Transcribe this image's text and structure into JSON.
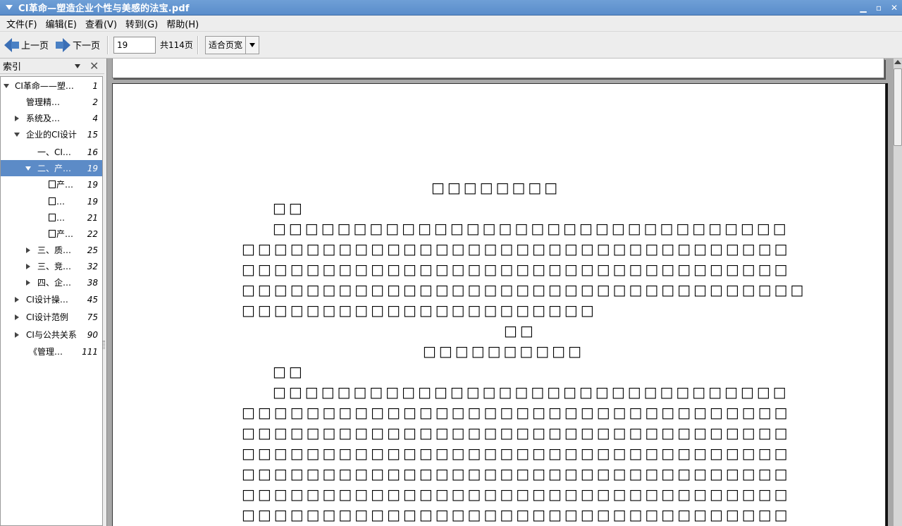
{
  "window": {
    "title": "CI革命—塑造企业个性与美感的法宝.pdf"
  },
  "menubar": [
    {
      "label": "文件(F)"
    },
    {
      "label": "编辑(E)"
    },
    {
      "label": "查看(V)"
    },
    {
      "label": "转到(G)"
    },
    {
      "label": "帮助(H)"
    }
  ],
  "toolbar": {
    "prev_label": "上一页",
    "next_label": "下一页",
    "page_value": "19",
    "total_label": "共114页",
    "zoom_label": "适合页宽"
  },
  "sidebar": {
    "header": "索引",
    "items": [
      {
        "label": "CI革命——塑…",
        "page": "1",
        "expander": "open"
      },
      {
        "label": "管理精…",
        "page": "2",
        "expander": "none"
      },
      {
        "label": "系统及…",
        "page": "4",
        "expander": "closed"
      },
      {
        "label": "企业的CI设计",
        "page": "15",
        "expander": "open"
      },
      {
        "label": "一、CI…",
        "page": "16",
        "expander": "none"
      },
      {
        "label": "二、产…",
        "page": "19",
        "expander": "open",
        "selected": true
      },
      {
        "label": "产…",
        "page": "19",
        "expander": "none",
        "boxes": 1
      },
      {
        "label": "…",
        "page": "19",
        "expander": "none",
        "boxes": 1
      },
      {
        "label": "…",
        "page": "21",
        "expander": "none",
        "boxes": 1
      },
      {
        "label": "产…",
        "page": "22",
        "expander": "none",
        "boxes": 1
      },
      {
        "label": "三、质…",
        "page": "25",
        "expander": "closed"
      },
      {
        "label": "三、竞…",
        "page": "32",
        "expander": "closed"
      },
      {
        "label": "四、企…",
        "page": "38",
        "expander": "closed"
      },
      {
        "label": "CI设计操…",
        "page": "45",
        "expander": "closed"
      },
      {
        "label": "CI设计范例",
        "page": "75",
        "expander": "closed"
      },
      {
        "label": "CI与公共关系",
        "page": "90",
        "expander": "closed"
      },
      {
        "label": "《管理…",
        "page": "111",
        "expander": "none"
      }
    ]
  },
  "document": {
    "lines": [
      "□□□□□□□□",
      "□□",
      "□□□□□□□□□□□□□□□□□□□□□□□□□□□□□□□□",
      "□□□□□□□□□□□□□□□□□□□□□□□□□□□□□□□□□□",
      "□□□□□□□□□□□□□□□□□□□□□□□□□□□□□□□□□□",
      "□□□□□□□□□□□□□□□□□□□□□□□□□□□□□□□□□□□",
      "□□□□□□□□□□□□□□□□□□□□□□",
      "□□",
      "□□□□□□□□□□",
      "□□",
      "□□□□□□□□□□□□□□□□□□□□□□□□□□□□□□□□",
      "□□□□□□□□□□□□□□□□□□□□□□□□□□□□□□□□□□",
      "□□□□□□□□□□□□□□□□□□□□□□□□□□□□□□□□□□",
      "□□□□□□□□□□□□□□□□□□□□□□□□□□□□□□□□□□",
      "□□□□□□□□□□□□□□□□□□□□□□□□□□□□□□□□□□",
      "□□□□□□□□□□□□□□□□□□□□□□□□□□□□□□□□□□",
      "□□□□□□□□□□□□□□□□□□□□□□□□□□□□□□□□□□"
    ]
  }
}
